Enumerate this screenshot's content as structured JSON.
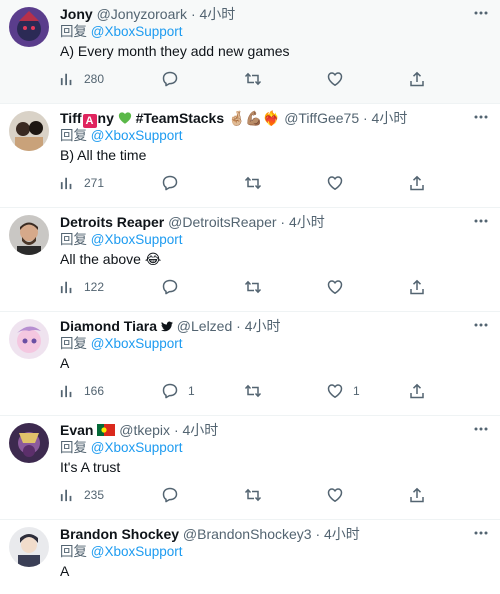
{
  "reply_label": "回复",
  "tweets": [
    {
      "name": "Jony",
      "handle": "@Jonyzoroark",
      "time": "· 4小时",
      "reply_to": "@XboxSupport",
      "text": "A) Every month they add new games",
      "views": "280",
      "replies": "",
      "likes": ""
    },
    {
      "name_part1": "Tiff",
      "name_badge": "A",
      "name_part2": "ny",
      "name_tag": "#TeamStacks",
      "name_emoji": "🤞🏼💪🏽❤️‍🔥",
      "handle": "@TiffGee75",
      "time": "· 4小时",
      "reply_to": "@XboxSupport",
      "text": "B) All the time",
      "views": "271",
      "replies": "",
      "likes": ""
    },
    {
      "name": "Detroits Reaper",
      "handle": "@DetroitsReaper",
      "time": "· 4小时",
      "reply_to": "@XboxSupport",
      "text": "All the above 😂",
      "views": "122",
      "replies": "",
      "likes": ""
    },
    {
      "name": "Diamond Tiara",
      "handle": "@Lelzed",
      "time": "· 4小时",
      "reply_to": "@XboxSupport",
      "text": "A",
      "views": "166",
      "replies": "1",
      "likes": "1"
    },
    {
      "name": "Evan",
      "handle": "@tkepix",
      "time": "· 4小时",
      "reply_to": "@XboxSupport",
      "text": "It's A trust",
      "views": "235",
      "replies": "",
      "likes": ""
    },
    {
      "name": "Brandon Shockey",
      "handle": "@BrandonShockey3",
      "time": "· 4小时",
      "reply_to": "@XboxSupport",
      "text": "A",
      "views": "",
      "replies": "",
      "likes": ""
    }
  ]
}
